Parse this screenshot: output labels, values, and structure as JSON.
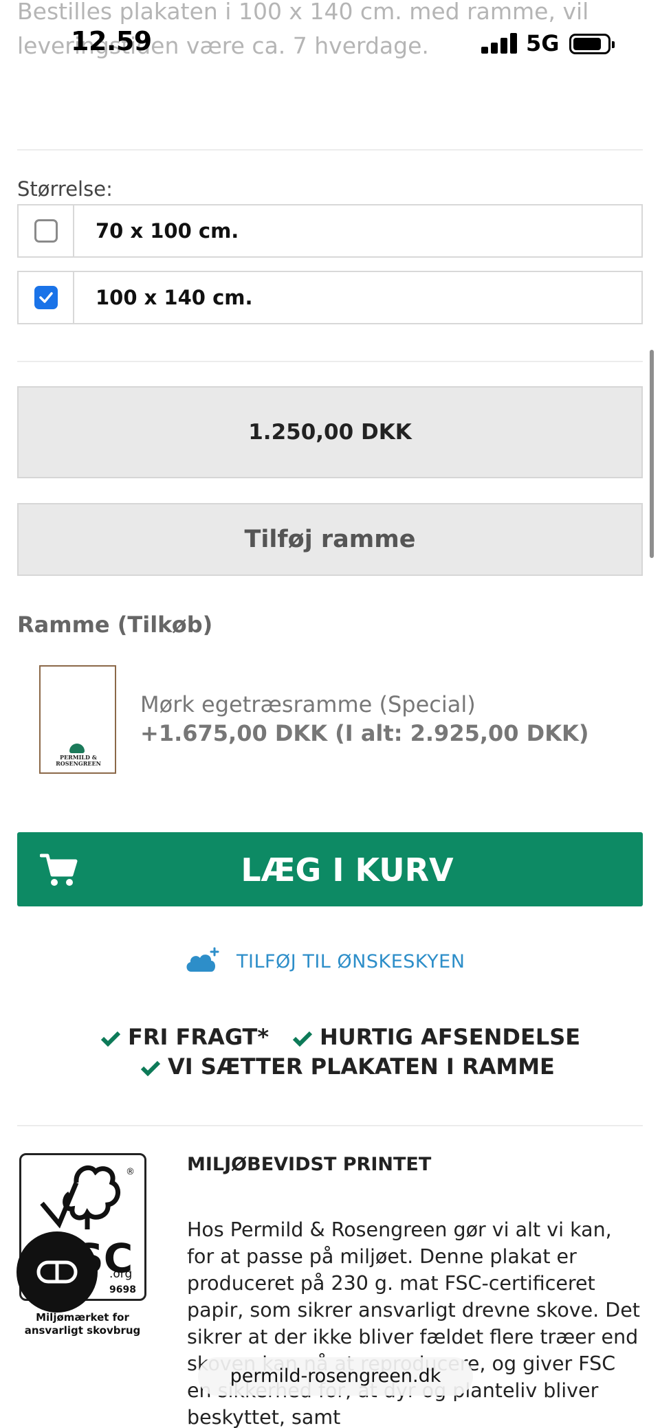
{
  "page": {
    "top_text": "Bestilles plakaten i 100 x 140 cm. med ramme, vil leveringstiden være ca. 7 hverdage."
  },
  "status_bar": {
    "time": "12.59",
    "network": "5G",
    "icons": [
      "signal-icon",
      "battery-icon"
    ]
  },
  "size_selector": {
    "label": "Størrelse:",
    "options": [
      {
        "label": "70 x 100 cm.",
        "checked": false
      },
      {
        "label": "100 x 140 cm.",
        "checked": true
      }
    ]
  },
  "price": "1.250,00 DKK",
  "add_frame_button": "Tilføj ramme",
  "frame_addon": {
    "title": "Ramme (Tilkøb)",
    "name": "Mørk egetræsramme (Special)",
    "price": "+1.675,00 DKK (I alt: 2.925,00 DKK)",
    "thumb_logo_text": "PERMILD & ROSENGREEN"
  },
  "cart_button": {
    "label": "LÆG I KURV",
    "icon": "cart-icon",
    "color": "#0d8a64"
  },
  "wishlist": {
    "label": "TILFØJ TIL ØNSKESKYEN",
    "icon": "cloud-plus-icon",
    "color": "#2d8ec9"
  },
  "usps": [
    "FRI FRAGT*",
    "HURTIG AFSENDELSE",
    "VI SÆTTER PLAKATEN I RAMME"
  ],
  "eco": {
    "title": "MILJØBEVIDST PRINTET",
    "text": "Hos Permild & Rosengreen gør vi alt vi kan, for at passe på miljøet. Denne plakat er produceret på 230 g. mat FSC-certificeret papir, som sikrer ansvarligt drevne skove. Det sikrer at der ikke bliver fældet flere træer end skoven kan nå at reproducere, og giver FSC en sikkerhed for, at dyr og planteliv bliver beskyttet, samt",
    "fsc_caption": "Miljømærket for ansvarligt skovbrug",
    "fsc_org": ".org",
    "fsc_code": "9698",
    "fsc_letters": "SC"
  },
  "browser": {
    "url": "permild-rosengreen.dk"
  }
}
